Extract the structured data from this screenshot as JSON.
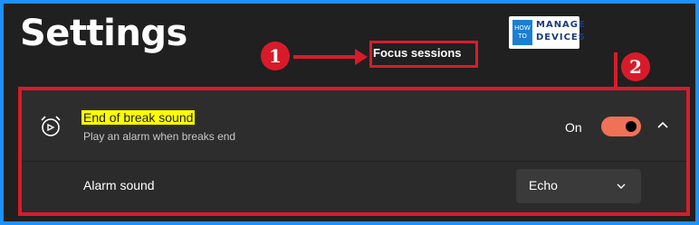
{
  "page": {
    "title": "Settings"
  },
  "logo": {
    "how_to": "HOW TO",
    "manage": "MANAGE",
    "devices": "DEVICES"
  },
  "annotations": {
    "marker_1": "1",
    "marker_2": "2",
    "focus_label": "Focus sessions"
  },
  "setting": {
    "title": "End of break sound",
    "description": "Play an alarm when breaks end",
    "state_label": "On",
    "toggle_on": true,
    "icon": "alarm-clock-icon"
  },
  "alarm_sound": {
    "label": "Alarm sound",
    "selected": "Echo"
  },
  "colors": {
    "accent": "#f07156",
    "annotation": "#d81b2a",
    "highlight": "#ffff00"
  }
}
